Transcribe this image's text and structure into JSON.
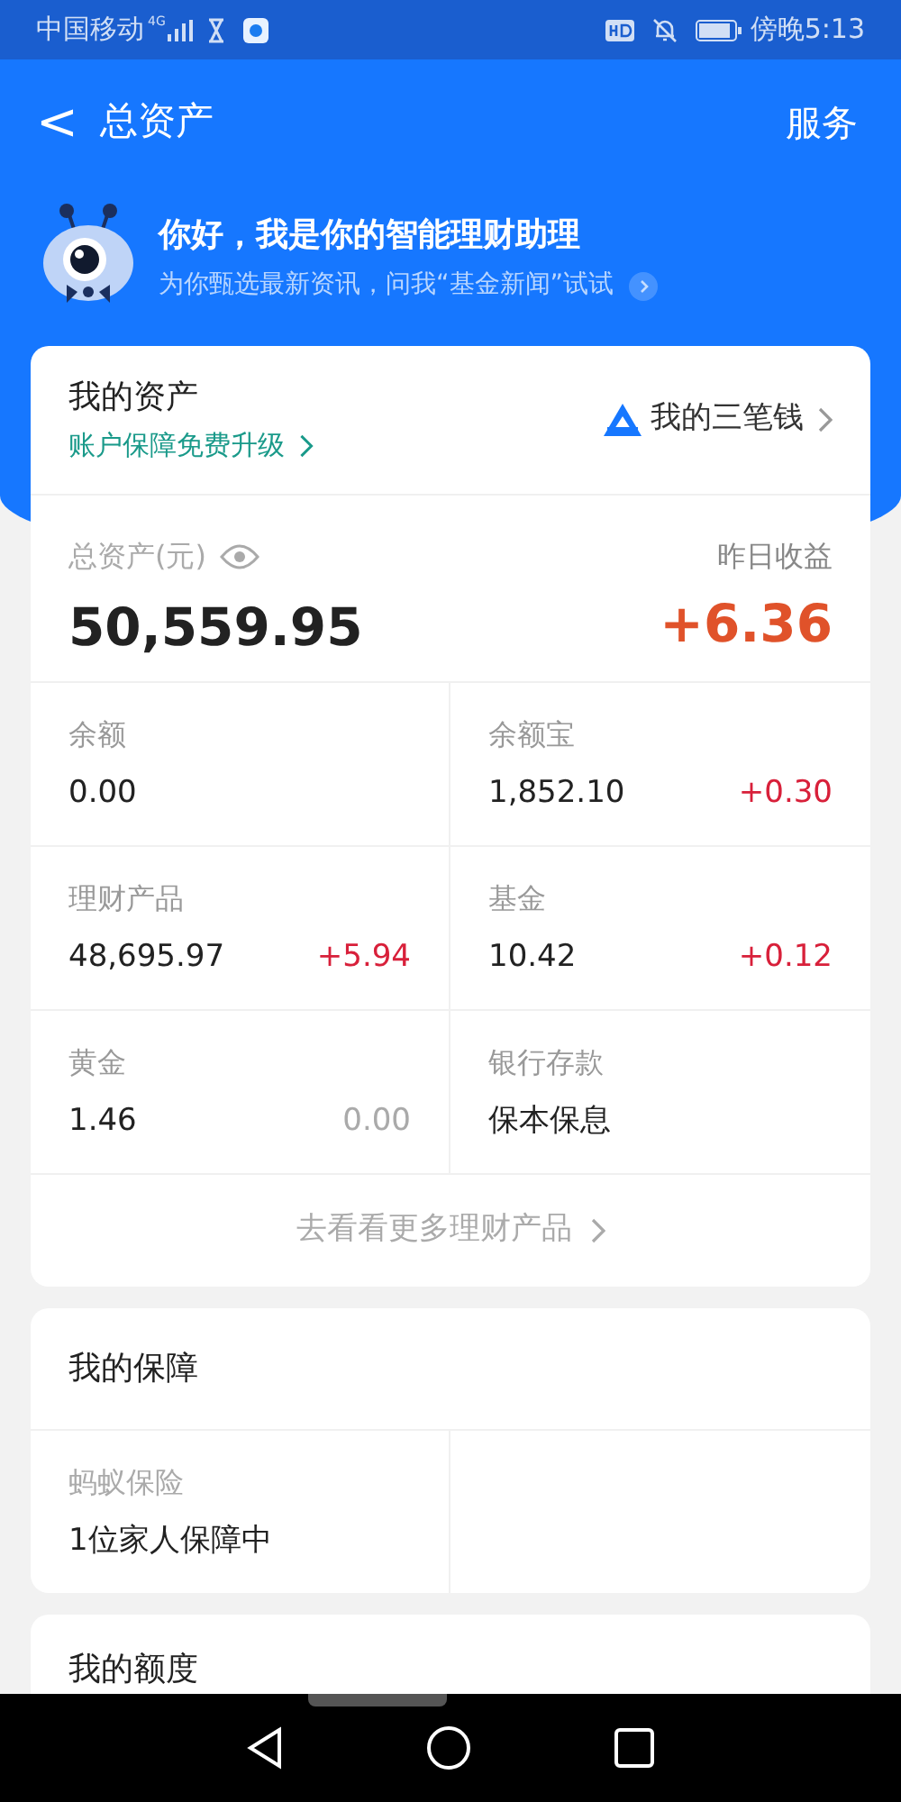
{
  "status_bar": {
    "carrier": "中国移动",
    "network": "4G",
    "time": "傍晚5:13"
  },
  "header": {
    "back": "<",
    "title": "总资产",
    "action": "服务"
  },
  "assistant": {
    "greeting": "你好，我是你的智能理财助理",
    "hint": "为你甄选最新资讯，问我“基金新闻”试试"
  },
  "assets_card": {
    "title": "我的资产",
    "upgrade_link": "账户保障免费升级",
    "plan_link": "我的三笔钱",
    "total_label": "总资产(元)",
    "total": "50,559.95",
    "yesterday_label": "昨日收益",
    "yesterday": "+6.36",
    "items": [
      {
        "label": "余额",
        "value": "0.00"
      },
      {
        "label": "余额宝",
        "value": "1,852.10",
        "change": "+0.30",
        "color": "#d8203a"
      },
      {
        "label": "理财产品",
        "value": "48,695.97",
        "change": "+5.94",
        "color": "#d8203a"
      },
      {
        "label": "基金",
        "value": "10.42",
        "change": "+0.12",
        "color": "#d8203a"
      },
      {
        "label": "黄金",
        "value": "1.46",
        "change": "0.00",
        "color": "#aaaaaa"
      },
      {
        "label": "银行存款",
        "value": "保本保息"
      }
    ],
    "more_link": "去看看更多理财产品"
  },
  "protection_card": {
    "title": "我的保障",
    "items": [
      {
        "label": "蚂蚁保险",
        "value": "1位家人保障中"
      }
    ]
  },
  "quota_card": {
    "title": "我的额度"
  }
}
